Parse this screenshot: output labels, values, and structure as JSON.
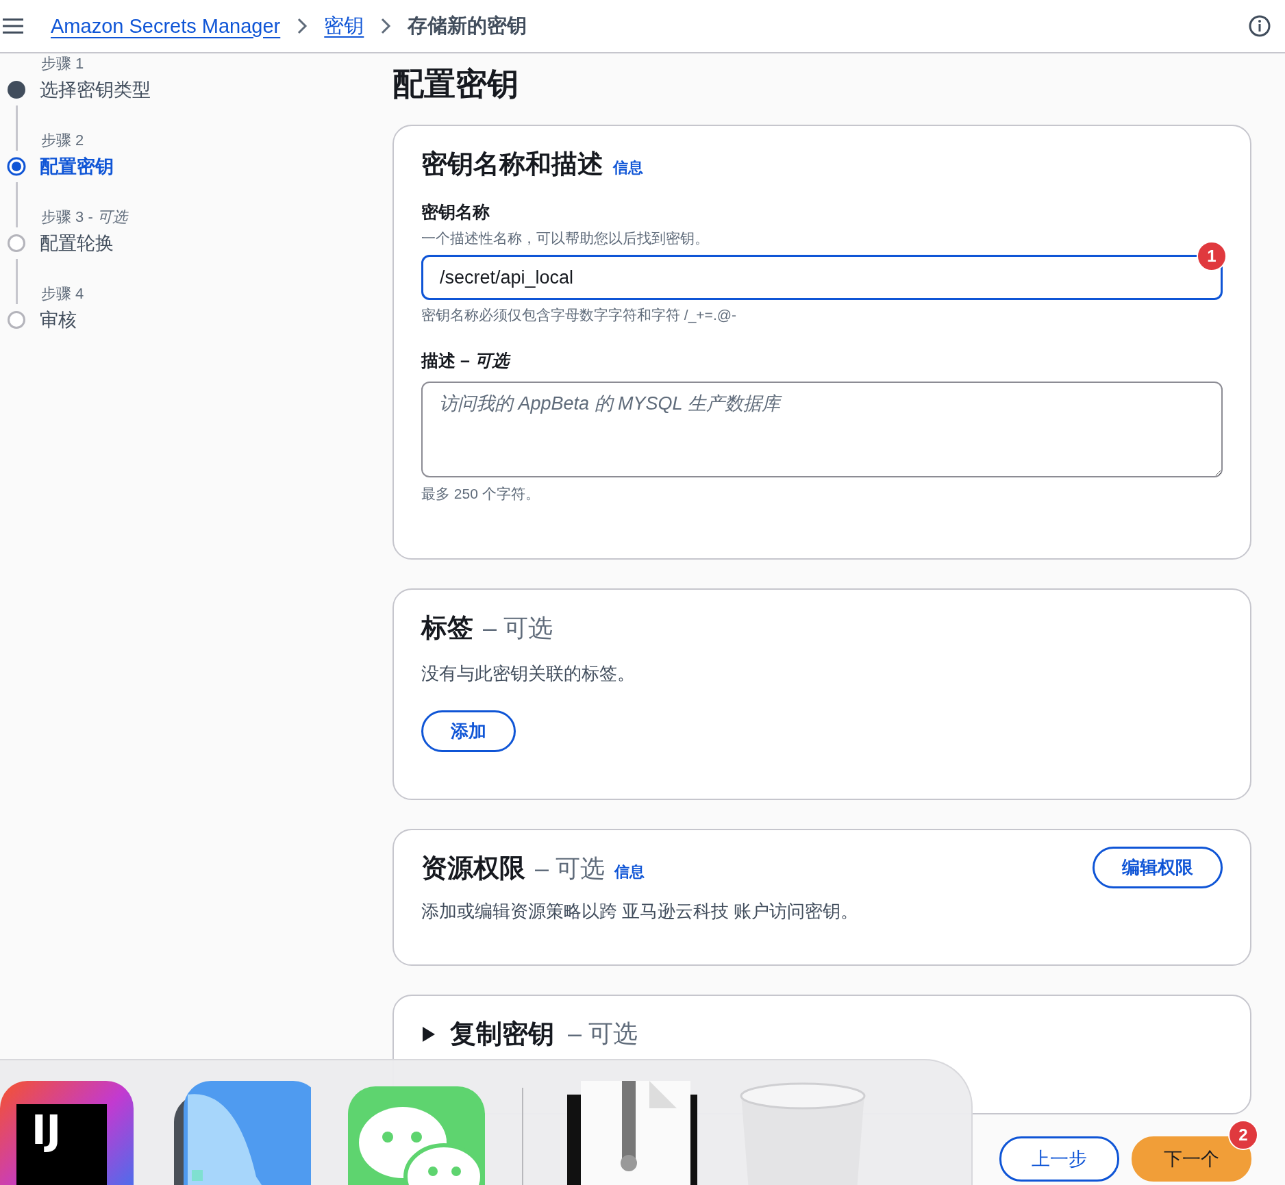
{
  "header": {
    "breadcrumbs": [
      {
        "label": "Amazon Secrets Manager",
        "link": true
      },
      {
        "label": "密钥",
        "link": true
      },
      {
        "label": "存储新的密钥",
        "link": false
      }
    ]
  },
  "steps": [
    {
      "step": "步骤 1",
      "label": "选择密钥类型",
      "completed": true,
      "selected": false
    },
    {
      "step": "步骤 2",
      "label": "配置密钥",
      "completed": false,
      "selected": true
    },
    {
      "step": "步骤 3 - *可选*",
      "label": "配置轮换",
      "completed": false,
      "selected": false
    },
    {
      "step": "步骤 4",
      "label": "审核",
      "completed": false,
      "selected": false
    }
  ],
  "page_title": "配置密钥",
  "sections": [
    {
      "kind": "form",
      "title": "密钥名称和描述",
      "info": "信息",
      "name_label": "密钥名称",
      "name_hint": "一个描述性名称，可以帮助您以后找到密钥。",
      "name_value": "/secret/api_local",
      "name_badge": "1",
      "name_constraint": "密钥名称必须仅包含字母数字字符和字符 /_+=.@-",
      "desc_label": "描述 – *可选*",
      "desc_placeholder": "访问我的 AppBeta 的 MYSQL 生产数据库",
      "desc_limit": "最多 250 个字符。"
    },
    {
      "kind": "tags",
      "title": "标签",
      "optional": "– 可选",
      "text": "没有与此密钥关联的标签。",
      "button": "添加"
    },
    {
      "kind": "permissions",
      "title": "资源权限",
      "optional": "– 可选",
      "info": "信息",
      "text": "添加或编辑资源策略以跨 亚马逊云科技 账户访问密钥。",
      "button": "编辑权限"
    },
    {
      "kind": "collapsible",
      "title": "复制密钥",
      "optional": "– 可选",
      "expanded": false
    }
  ],
  "footer_buttons": [
    {
      "label": "上一步",
      "primary": false
    },
    {
      "label": "下一个",
      "primary": true,
      "badge": "2"
    }
  ],
  "dock": [
    {
      "kind": "intellij",
      "label": "IJ"
    },
    {
      "kind": "preview"
    },
    {
      "kind": "wechat"
    },
    {
      "kind": "separator"
    },
    {
      "kind": "archive"
    },
    {
      "kind": "trash"
    }
  ]
}
